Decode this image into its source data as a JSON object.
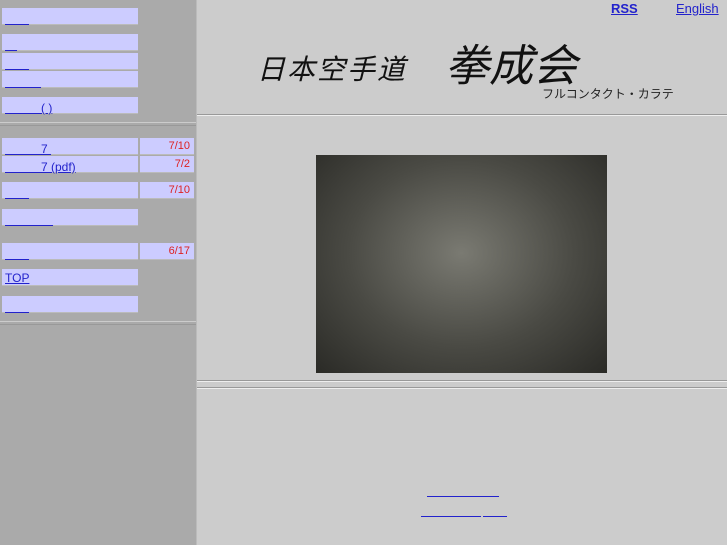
{
  "sidebar": {
    "group1": [
      {
        "label": "　　"
      },
      {
        "label": "　"
      },
      {
        "label": "　　"
      },
      {
        "label": "　　　"
      },
      {
        "label": "　　　( )"
      }
    ],
    "group2": [
      {
        "label": "　　　7 ",
        "date": "7/10"
      },
      {
        "label": "　　　7 (pdf)",
        "date": "7/2"
      },
      {
        "label": "　　",
        "date": "7/10"
      },
      {
        "label": "　　　　"
      },
      {
        "label": "　　",
        "date": "6/17"
      },
      {
        "label": "TOP"
      },
      {
        "label": "　　"
      }
    ]
  },
  "header": {
    "rss": "RSS",
    "english": "English",
    "logo_small": "日本空手道",
    "logo_large": "拳成会",
    "subtitle": "フルコンタクト・カラテ"
  },
  "footer": {
    "link1": "　　　　　　",
    "link2": "　　　　　",
    "link3": "　　"
  }
}
